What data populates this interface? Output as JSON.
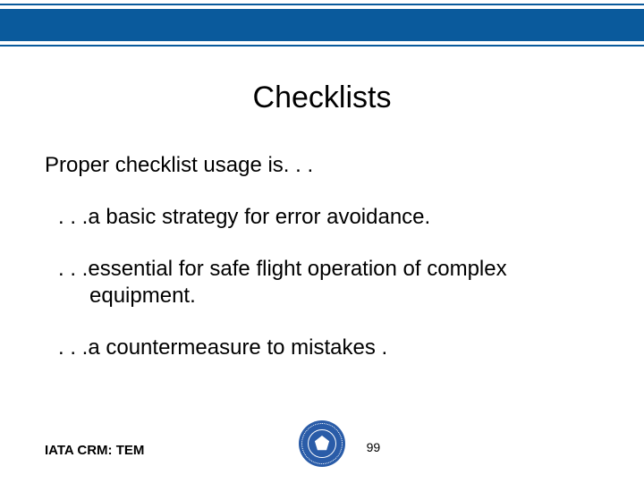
{
  "header": {
    "title": "Checklists"
  },
  "body": {
    "lead": "Proper checklist usage is. . .",
    "point1": ". . .a basic strategy for error avoidance.",
    "point2_l1": ". . .essential for safe flight operation of complex",
    "point2_l2": "equipment.",
    "point3": ". . .a countermeasure to mistakes ."
  },
  "footer": {
    "left": "IATA CRM: TEM",
    "page": "99"
  }
}
